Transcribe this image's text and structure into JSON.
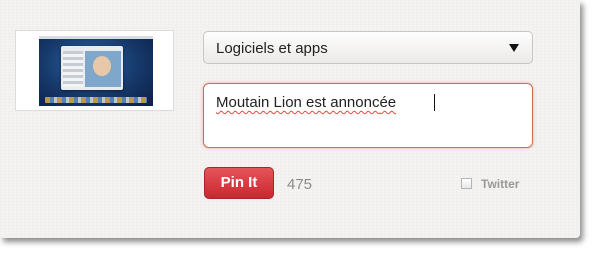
{
  "pin_form": {
    "board_select": {
      "selected": "Logiciels et apps",
      "arrow_icon": "triangle-down-icon"
    },
    "description": {
      "value_main": "Moutain Lion est annonc",
      "value_tail": "ée"
    },
    "pin_button_label": "Pin It",
    "char_count": "475",
    "twitter": {
      "label": "Twitter",
      "checked": false
    },
    "thumbnail": {
      "icon": "mac-desktop-screenshot-thumbnail"
    },
    "colors": {
      "pin_button": "#cb2027",
      "textarea_border": "#d06a5c",
      "count_text": "#8a8a8a"
    }
  }
}
